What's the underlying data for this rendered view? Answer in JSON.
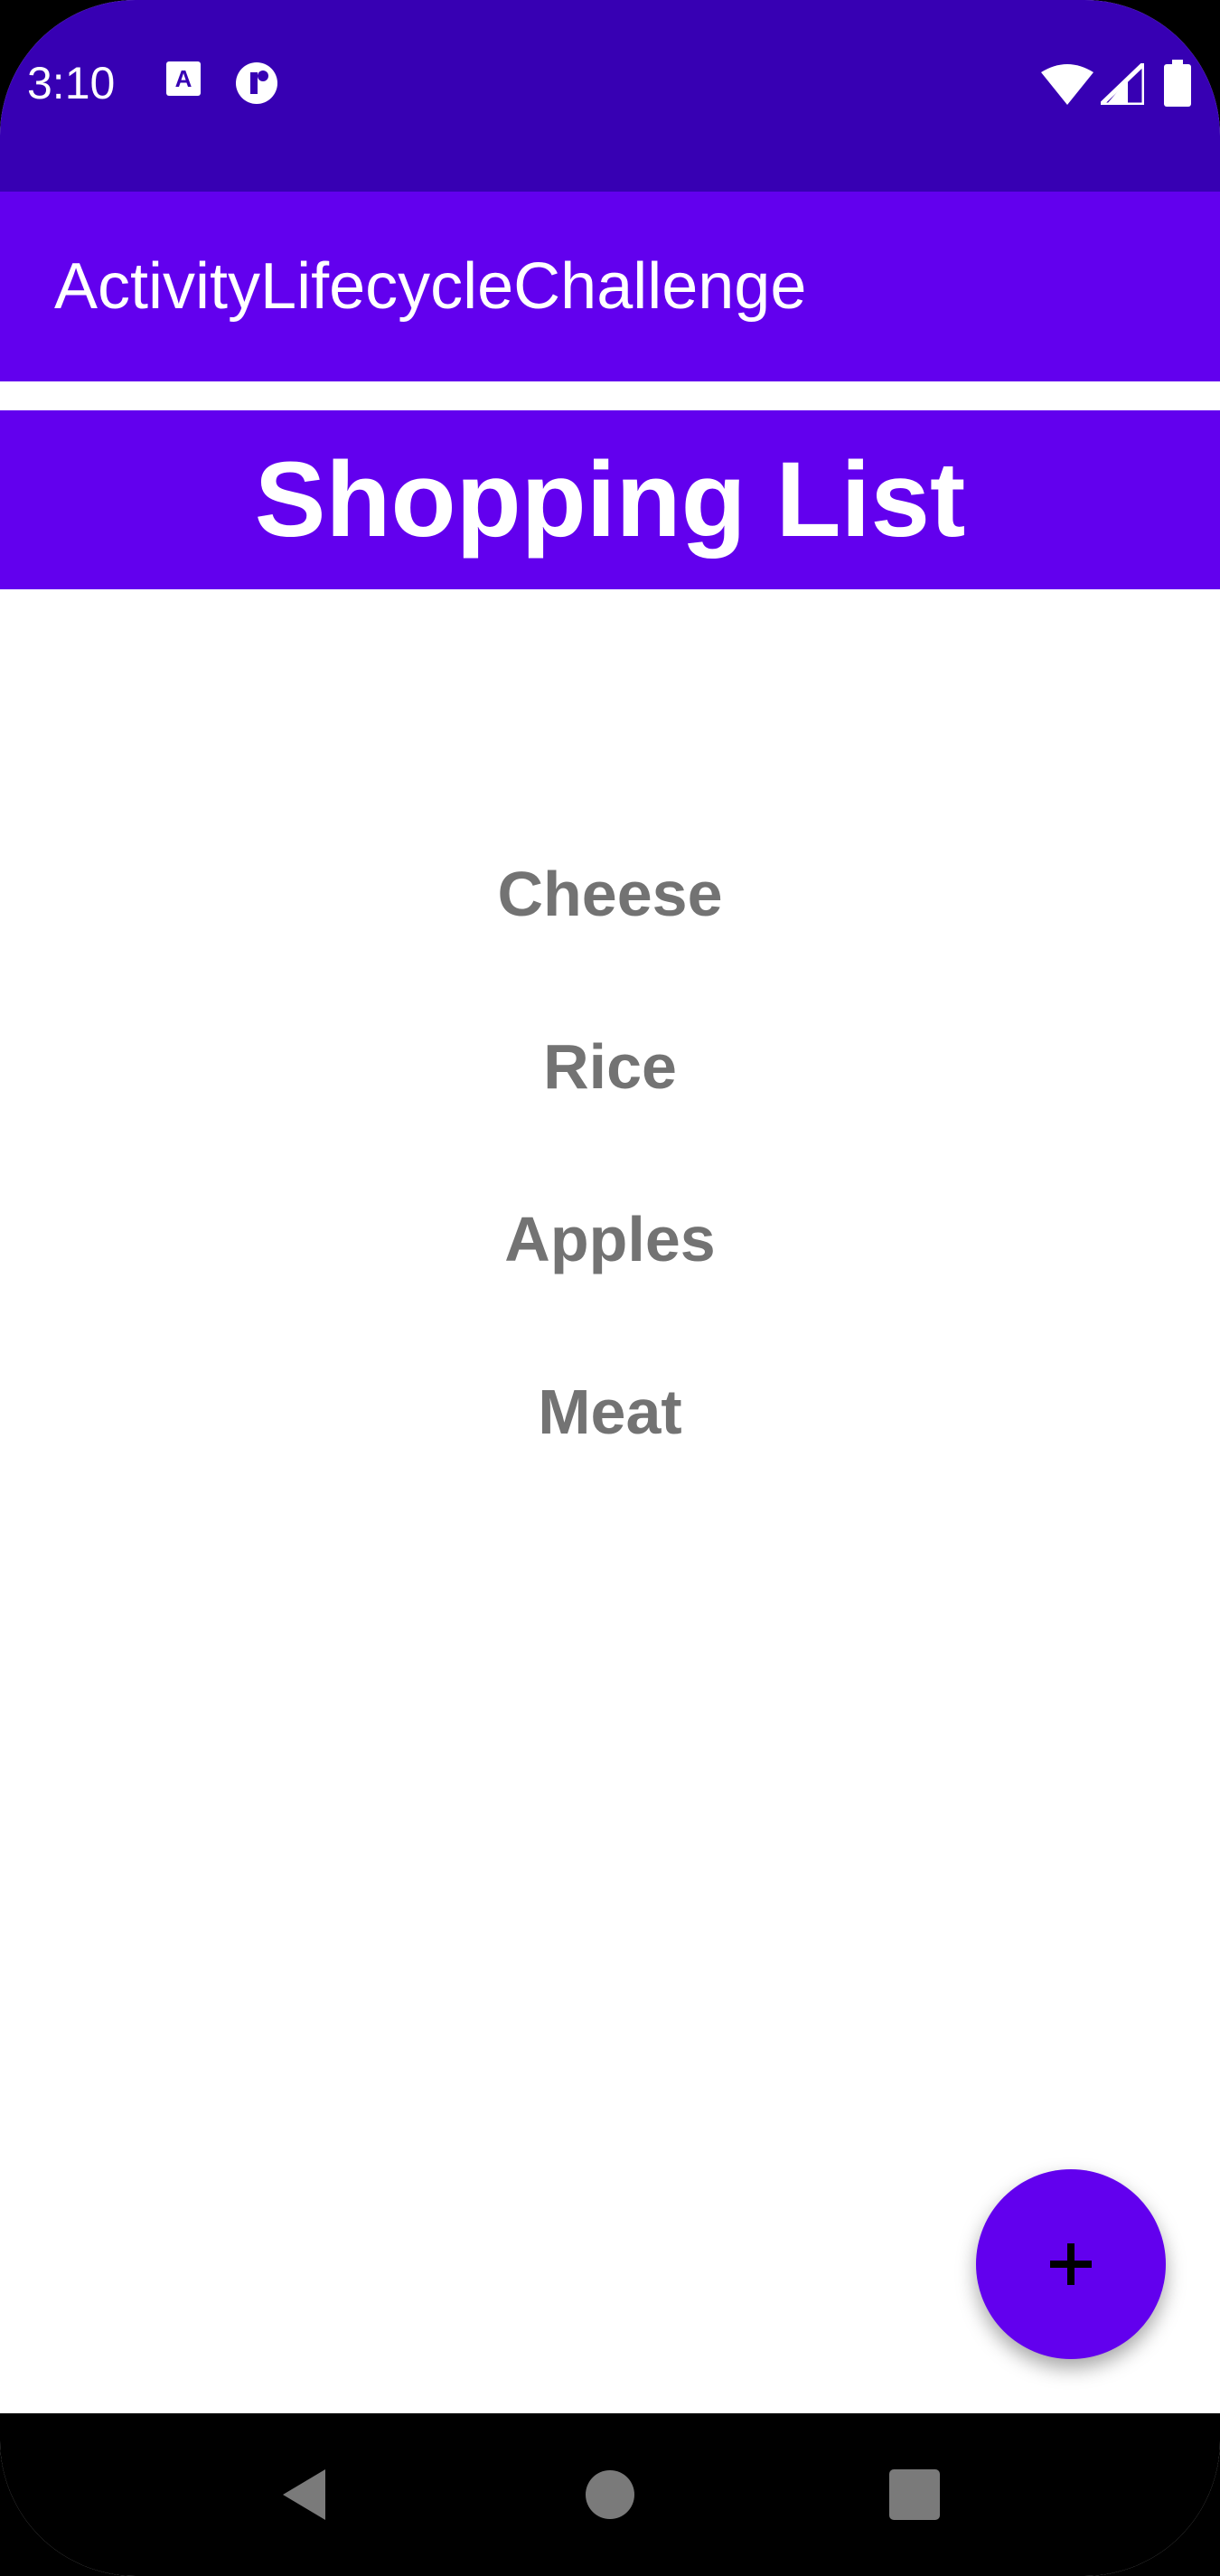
{
  "status_bar": {
    "time": "3:10",
    "left_icons": [
      "font-a-icon",
      "circle-notification-icon"
    ],
    "right_icons": [
      "wifi-icon",
      "cellular-signal-icon",
      "battery-icon"
    ]
  },
  "app_bar": {
    "title": "ActivityLifecycleChallenge"
  },
  "list_header": {
    "title": "Shopping List"
  },
  "shopping_items": [
    {
      "label": "Cheese"
    },
    {
      "label": "Rice"
    },
    {
      "label": "Apples"
    },
    {
      "label": "Meat"
    }
  ],
  "fab": {
    "icon": "add-icon"
  },
  "nav_bar": {
    "buttons": [
      "back-icon",
      "home-icon",
      "recents-icon"
    ]
  },
  "colors": {
    "status_bar": "#3700b3",
    "primary": "#6200ee",
    "item_text": "#737373",
    "background": "#ffffff"
  }
}
